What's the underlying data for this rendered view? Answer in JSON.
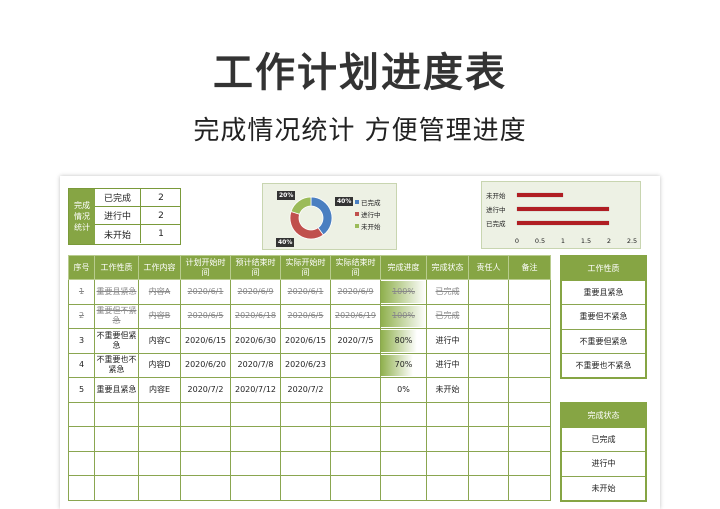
{
  "header": {
    "title": "工作计划进度表",
    "subtitle": "完成情况统计  方便管理进度"
  },
  "summary": {
    "side_label": "完成情况统计",
    "rows": [
      {
        "label": "已完成",
        "value": "2"
      },
      {
        "label": "进行中",
        "value": "2"
      },
      {
        "label": "未开始",
        "value": "1"
      }
    ]
  },
  "donut": {
    "labels": [
      "20%",
      "40%",
      "40%"
    ],
    "legend": [
      "已完成",
      "进行中",
      "未开始"
    ],
    "colors": [
      "#4a7fc1",
      "#c0504d",
      "#9bbb59"
    ],
    "shares": [
      0.4,
      0.4,
      0.2
    ]
  },
  "chart_data": {
    "type": "bar",
    "orientation": "horizontal",
    "categories": [
      "未开始",
      "进行中",
      "已完成"
    ],
    "values": [
      1,
      2,
      2
    ],
    "xlim": [
      0,
      2.5
    ],
    "xticks": [
      "0",
      "0.5",
      "1",
      "1.5",
      "2",
      "2.5"
    ],
    "bar_color": "#b01e23"
  },
  "table": {
    "headers": [
      "序号",
      "工作性质",
      "工作内容",
      "计划开始时间",
      "预计结束时间",
      "实际开始时间",
      "实际结束时间",
      "完成进度",
      "完成状态",
      "责任人",
      "备注"
    ],
    "rows": [
      {
        "cells": [
          "1",
          "重要且紧急",
          "内容A",
          "2020/6/1",
          "2020/6/9",
          "2020/6/1",
          "2020/6/9",
          "100%",
          "已完成",
          "",
          ""
        ],
        "done": true,
        "progress": 1.0
      },
      {
        "cells": [
          "2",
          "重要但不紧急",
          "内容B",
          "2020/6/5",
          "2020/6/18",
          "2020/6/5",
          "2020/6/19",
          "100%",
          "已完成",
          "",
          ""
        ],
        "done": true,
        "progress": 1.0
      },
      {
        "cells": [
          "3",
          "不重要但紧急",
          "内容C",
          "2020/6/15",
          "2020/6/30",
          "2020/6/15",
          "2020/7/5",
          "80%",
          "进行中",
          "",
          ""
        ],
        "done": false,
        "progress": 0.8
      },
      {
        "cells": [
          "4",
          "不重要也不紧急",
          "内容D",
          "2020/6/20",
          "2020/7/8",
          "2020/6/23",
          "",
          "70%",
          "进行中",
          "",
          ""
        ],
        "done": false,
        "progress": 0.7
      },
      {
        "cells": [
          "5",
          "重要且紧急",
          "内容E",
          "2020/7/2",
          "2020/7/12",
          "2020/7/2",
          "",
          "0%",
          "未开始",
          "",
          ""
        ],
        "done": false,
        "progress": 0.0
      }
    ],
    "empty_rows": 4
  },
  "side_nature": {
    "header": "工作性质",
    "items": [
      "重要且紧急",
      "重要但不紧急",
      "不重要但紧急",
      "不重要也不紧急"
    ]
  },
  "side_status": {
    "header": "完成状态",
    "items": [
      "已完成",
      "进行中",
      "未开始"
    ]
  }
}
